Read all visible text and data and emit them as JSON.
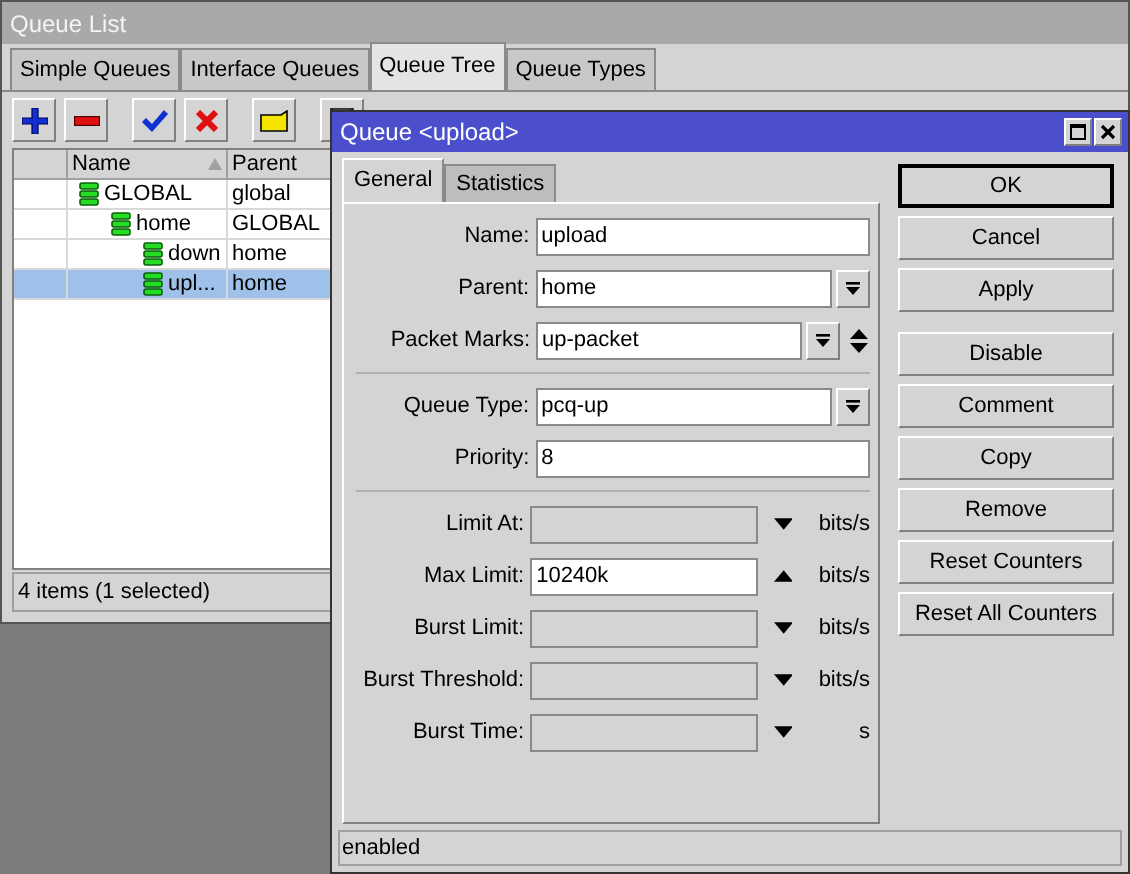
{
  "window": {
    "title": "Queue List"
  },
  "tabs": [
    {
      "label": "Simple Queues",
      "selected": false
    },
    {
      "label": "Interface Queues",
      "selected": false
    },
    {
      "label": "Queue Tree",
      "selected": true
    },
    {
      "label": "Queue Types",
      "selected": false
    }
  ],
  "table": {
    "columns": [
      "Name",
      "Parent"
    ],
    "rows": [
      {
        "name": "GLOBAL",
        "parent": "global",
        "selected": false,
        "children": [
          {
            "name": "home",
            "parent": "GLOBAL",
            "selected": false,
            "children": [
              {
                "name": "down",
                "parent": "home",
                "selected": false
              },
              {
                "name": "upl...",
                "parent": "home",
                "selected": true
              }
            ]
          }
        ]
      }
    ]
  },
  "status_bar": "4 items (1 selected)",
  "dialog": {
    "title": "Queue <upload>",
    "tabs": [
      {
        "label": "General",
        "selected": true
      },
      {
        "label": "Statistics",
        "selected": false
      }
    ],
    "groups": [
      [
        {
          "label": "Name:",
          "value": "upload",
          "kind": "text"
        },
        {
          "label": "Parent:",
          "value": "home",
          "kind": "dropdown"
        },
        {
          "label": "Packet Marks:",
          "value": "up-packet",
          "kind": "multi"
        }
      ],
      [
        {
          "label": "Queue Type:",
          "value": "pcq-up",
          "kind": "dropdown"
        },
        {
          "label": "Priority:",
          "value": "8",
          "kind": "text"
        }
      ],
      [
        {
          "label": "Limit At:",
          "kind": "limit",
          "expanded": false,
          "unit": "bits/s"
        },
        {
          "label": "Max Limit:",
          "value": "10240k",
          "kind": "limit",
          "expanded": true,
          "unit": "bits/s"
        },
        {
          "label": "Burst Limit:",
          "kind": "limit",
          "expanded": false,
          "unit": "bits/s"
        },
        {
          "label": "Burst Threshold:",
          "kind": "limit",
          "expanded": false,
          "unit": "bits/s"
        },
        {
          "label": "Burst Time:",
          "kind": "limit",
          "expanded": false,
          "unit": "s"
        }
      ]
    ],
    "buttons": [
      {
        "label": "OK",
        "default": true
      },
      {
        "label": "Cancel",
        "default": false
      },
      {
        "label": "Apply",
        "default": false
      },
      {
        "label": "Disable",
        "default": false
      },
      {
        "label": "Comment",
        "default": false
      },
      {
        "label": "Copy",
        "default": false
      },
      {
        "label": "Remove",
        "default": false
      },
      {
        "label": "Reset Counters",
        "default": false
      },
      {
        "label": "Reset All Counters",
        "default": false
      }
    ],
    "status": "enabled"
  }
}
